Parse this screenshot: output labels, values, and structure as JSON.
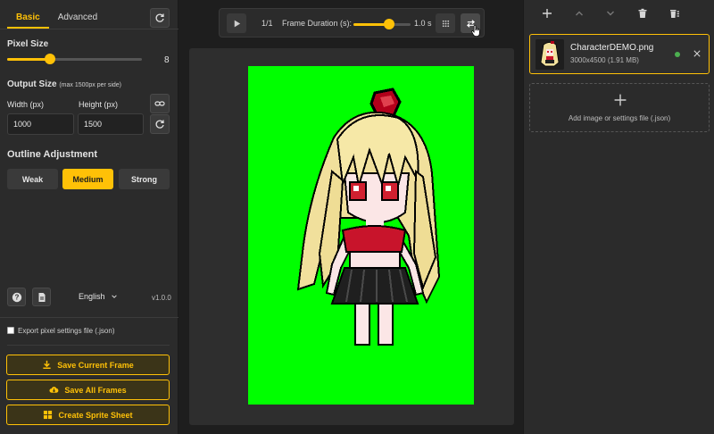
{
  "left": {
    "tabs": [
      {
        "label": "Basic",
        "active": true
      },
      {
        "label": "Advanced",
        "active": false
      }
    ],
    "pixel_size": {
      "label": "Pixel Size",
      "value": "8",
      "fraction": 0.32
    },
    "output_size": {
      "label": "Output Size",
      "hint": "(max 1500px per side)",
      "width_label": "Width (px)",
      "width_value": "1000",
      "height_label": "Height (px)",
      "height_value": "1500"
    },
    "outline": {
      "label": "Outline Adjustment",
      "options": [
        "Weak",
        "Medium",
        "Strong"
      ],
      "selected": "Medium"
    },
    "language": "English",
    "version": "v1.0.0",
    "export_label": "Export pixel settings file (.json)",
    "actions": {
      "save_current": "Save Current Frame",
      "save_all": "Save All Frames",
      "sprite_sheet": "Create Sprite Sheet"
    }
  },
  "toolbar": {
    "frame_counter": "1/1",
    "duration_label": "Frame Duration (s):",
    "duration_value": "1.0 s",
    "duration_fraction": 0.62
  },
  "files": {
    "items": [
      {
        "name": "CharacterDEMO.png",
        "meta": "3000x4500 (1.91 MB)",
        "status_color": "#4caf50"
      }
    ],
    "add_label": "Add image or settings file (.json)"
  },
  "colors": {
    "accent": "#ffc107",
    "canvas_bg": "#00ff00"
  }
}
